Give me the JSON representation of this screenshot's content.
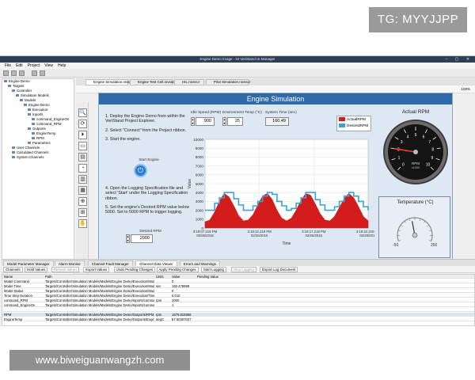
{
  "overlays": {
    "top_right_tag": "TG: MYYJJPP",
    "bottom_left_url": "www.biweiguanwangzh.com"
  },
  "window": {
    "title": "Engine Demo Image - NI VeriStand UI Manager",
    "controls": "–  ▢  ✕"
  },
  "menu": [
    "File",
    "Edit",
    "Project",
    "View",
    "Help"
  ],
  "tree": [
    {
      "label": "Engine Demo",
      "level": 0
    },
    {
      "label": "Targets",
      "level": 1
    },
    {
      "label": "Controller",
      "level": 2
    },
    {
      "label": "Simulation Models",
      "level": 3
    },
    {
      "label": "Models",
      "level": 4
    },
    {
      "label": "Engine Demo",
      "level": 5
    },
    {
      "label": "Execution",
      "level": 6
    },
    {
      "label": "Inports",
      "level": 6
    },
    {
      "label": "command_EngineOn",
      "level": 7
    },
    {
      "label": "command_RPM",
      "level": 7
    },
    {
      "label": "Outports",
      "level": 6
    },
    {
      "label": "EngineTemp",
      "level": 7
    },
    {
      "label": "RPM",
      "level": 7
    },
    {
      "label": "Parameters",
      "level": 6
    },
    {
      "label": "User Channels",
      "level": 2
    },
    {
      "label": "Calculated Channels",
      "level": 2
    },
    {
      "label": "System Channels",
      "level": 2
    }
  ],
  "tool_strip": [
    "🔍",
    "⟳",
    "⏵",
    "▭",
    "▤",
    "◔",
    "▥",
    "▦",
    "⊕",
    "⊞",
    "✋"
  ],
  "doc_tabs": [
    {
      "label": "Engine Simulation.nivsscr",
      "active": true
    },
    {
      "label": "Engine Test Cell.nivsscr",
      "active": false
    },
    {
      "label": "HIL.nivsscr",
      "active": false
    },
    {
      "label": "Pilot Simulation.nivsscr",
      "active": false
    }
  ],
  "zoom": "100%",
  "panel": {
    "title": "Engine Simulation",
    "instructions": [
      "1. Deploy the Engine Demo from within the VeriStand Project Explorer.",
      "2. Select \"Connect\" from the Project ribbon.",
      "3. Start the engine.",
      "4. Open the Logging Specification file and select 'Start' under the Logging Specification ribbon.",
      "5. Set the engine's Desired RPM value below 5000. Set to 5000 RPM to trigger logging."
    ],
    "start_engine_label": "Start Engine",
    "desired_rpm_label": "Desired RPM",
    "desired_rpm_value": "2000",
    "idle_speed_label": "Idle Speed (RPM)",
    "idle_speed_value": "900",
    "env_temp_label": "Environment Temp (°C)",
    "env_temp_value": "25",
    "system_time_label": "System Time (sec)",
    "system_time_value": "160.49",
    "legend_actual": "ActualRPM",
    "legend_desired": "DesiredRPM",
    "actual_rpm_title": "Actual RPM",
    "temperature_title": "Temperature (°C)",
    "temp_min": "-50",
    "temp_max": "250"
  },
  "chart_data": {
    "type": "area",
    "xlabel": "Time",
    "ylabel": "Value",
    "ylim": [
      0,
      10000
    ],
    "yticks": [
      "0",
      "1000",
      "2000",
      "3000",
      "4000",
      "5000",
      "6000",
      "7000",
      "8000",
      "9000",
      "10000"
    ],
    "xticks": [
      "3:19:07.219 PM\n02/26/2016",
      "3:19:12.219 PM\n02/26/2016",
      "3:19:17.219 PM\n02/26/2016",
      "3:19:22.219 PM\n02/26/2016"
    ],
    "series": [
      {
        "name": "ActualRPM",
        "color": "#d31d1d",
        "values": [
          700,
          900,
          1800,
          3000,
          3900,
          3500,
          2500,
          1400,
          800,
          900,
          1500,
          2600,
          3600,
          3900,
          3200,
          2000,
          1100,
          800,
          1100,
          2000,
          3100,
          3900,
          3700,
          2700,
          1600,
          900,
          800,
          1300,
          2300,
          3300,
          3900,
          3400,
          2400,
          1300,
          800
        ]
      },
      {
        "name": "DesiredRPM",
        "color": "#3aa3d2",
        "values": [
          2000,
          2000,
          2800,
          3400,
          4000,
          4000,
          3300,
          2600,
          2000,
          2000,
          2500,
          3000,
          3600,
          4000,
          3800,
          3000,
          2500,
          2000,
          2200,
          2800,
          3400,
          4000,
          4000,
          3200,
          2600,
          2000,
          2000,
          2400,
          3000,
          3600,
          4000,
          3600,
          3000,
          2400,
          2000
        ]
      }
    ],
    "legend": "top-right",
    "grid": true
  },
  "rpm_gauge": {
    "ticks": [
      "0",
      "1",
      "2",
      "3",
      "4",
      "5",
      "6",
      "7",
      "8",
      "9",
      "10"
    ],
    "unit": "RPM",
    "multiplier": "x1000",
    "value": 2.0
  },
  "temp_gauge": {
    "value": 85
  },
  "bottom_tabs": [
    {
      "label": "Model Parameter Manager",
      "active": false
    },
    {
      "label": "Alarm Monitor",
      "active": false
    },
    {
      "label": "Channel Fault Manager",
      "active": false
    },
    {
      "label": "Channel Data Viewer",
      "active": true
    },
    {
      "label": "Errors and Warnings",
      "active": false
    }
  ],
  "bottom_toolbar": [
    {
      "label": "Channels",
      "disabled": false
    },
    {
      "label": "Hold Values",
      "disabled": false
    },
    {
      "label": "Refresh Values",
      "disabled": true
    },
    {
      "label": "Export Values",
      "disabled": false
    },
    {
      "label": "Undo Pending Changes",
      "disabled": false
    },
    {
      "label": "Apply Pending Changes",
      "disabled": false
    },
    {
      "label": "Start Logging",
      "disabled": false
    },
    {
      "label": "Stop Logging",
      "disabled": true
    },
    {
      "label": "Export Log Document",
      "disabled": false
    }
  ],
  "grid": {
    "headers": [
      "Name",
      "Path",
      "Units",
      "Value",
      "Pending Value"
    ],
    "rows": [
      [
        "Model Command",
        "Targets/Controller/Simulation Models/Models/Engine Demo/Execution/Model Command",
        "",
        "0",
        ""
      ],
      [
        "Model Time",
        "Targets/Controller/Simulation Models/Models/Engine Demo/Execution/Model Time",
        "sec",
        "160.478999",
        ""
      ],
      [
        "Model Status",
        "Targets/Controller/Simulation Models/Models/Engine Demo/Execution/Model Status",
        "",
        "0",
        ""
      ],
      [
        "Time Step Duration",
        "Targets/Controller/Simulation Models/Models/Engine Demo/Execution/Time Step Duration",
        "",
        "0.010",
        ""
      ],
      [
        "command_RPM",
        "Targets/Controller/Simulation Models/Models/Engine Demo/Inports/command_RPM",
        "rpm",
        "2000",
        ""
      ],
      [
        "command_EngineOn",
        "Targets/Controller/Simulation Models/Models/Engine Demo/Inports/command_EngineOn",
        "",
        "1",
        ""
      ],
      [
        "",
        "",
        "",
        "",
        ""
      ],
      [
        "RPM",
        "Targets/Controller/Simulation Models/Models/Engine Demo/Outports/RPM",
        "rpm",
        "1579.815956",
        ""
      ],
      [
        "EngineTemp",
        "Targets/Controller/Simulation Models/Models/Engine Demo/Outports/EngineTemp",
        "degC",
        "87.50307047",
        ""
      ]
    ]
  }
}
